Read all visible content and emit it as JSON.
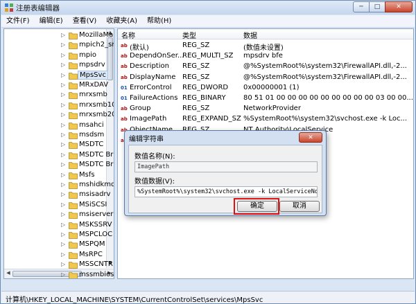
{
  "window": {
    "title": "注册表编辑器",
    "minimize": "─",
    "maximize": "□",
    "close": "✕"
  },
  "menu": [
    "文件(F)",
    "编辑(E)",
    "查看(V)",
    "收藏夹(A)",
    "帮助(H)"
  ],
  "tree": {
    "items": [
      {
        "label": "MozillaMa",
        "selected": false
      },
      {
        "label": "mpich2_sr",
        "selected": false
      },
      {
        "label": "mpio",
        "selected": false
      },
      {
        "label": "mpsdrv",
        "selected": false
      },
      {
        "label": "MpsSvc",
        "selected": true
      },
      {
        "label": "MRxDAV",
        "selected": false
      },
      {
        "label": "mrxsmb",
        "selected": false
      },
      {
        "label": "mrxsmb10",
        "selected": false
      },
      {
        "label": "mrxsmb20",
        "selected": false
      },
      {
        "label": "msahci",
        "selected": false
      },
      {
        "label": "msdsm",
        "selected": false
      },
      {
        "label": "MSDTC",
        "selected": false
      },
      {
        "label": "MSDTC Br",
        "selected": false
      },
      {
        "label": "MSDTC Br",
        "selected": false
      },
      {
        "label": "Msfs",
        "selected": false
      },
      {
        "label": "mshidkmd",
        "selected": false
      },
      {
        "label": "msisadrv",
        "selected": false
      },
      {
        "label": "MSiSCSI",
        "selected": false
      },
      {
        "label": "msiserver",
        "selected": false
      },
      {
        "label": "MSKSSRV",
        "selected": false
      },
      {
        "label": "MSPCLOC",
        "selected": false
      },
      {
        "label": "MSPQM",
        "selected": false
      },
      {
        "label": "MsRPC",
        "selected": false
      },
      {
        "label": "MSSCNTR",
        "selected": false
      },
      {
        "label": "mssmbios",
        "selected": false
      }
    ]
  },
  "list": {
    "columns": [
      "名称",
      "类型",
      "数据"
    ],
    "rows": [
      {
        "icon": "ab",
        "name": "(默认)",
        "type": "REG_SZ",
        "data": "(数值未设置)"
      },
      {
        "icon": "ab",
        "name": "DependOnSer...",
        "type": "REG_MULTI_SZ",
        "data": "mpsdrv bfe"
      },
      {
        "icon": "ab",
        "name": "Description",
        "type": "REG_SZ",
        "data": "@%SystemRoot%\\system32\\FirewallAPI.dll,-2..."
      },
      {
        "icon": "ab",
        "name": "DisplayName",
        "type": "REG_SZ",
        "data": "@%SystemRoot%\\system32\\FirewallAPI.dll,-2..."
      },
      {
        "icon": "bin",
        "name": "ErrorControl",
        "type": "REG_DWORD",
        "data": "0x00000001 (1)"
      },
      {
        "icon": "bin",
        "name": "FailureActions",
        "type": "REG_BINARY",
        "data": "80 51 01 00 00 00 00 00 00 00 00 00 03 00 00..."
      },
      {
        "icon": "ab",
        "name": "Group",
        "type": "REG_SZ",
        "data": "NetworkProvider"
      },
      {
        "icon": "ab",
        "name": "ImagePath",
        "type": "REG_EXPAND_SZ",
        "data": "%SystemRoot%\\system32\\svchost.exe -k Loc..."
      },
      {
        "icon": "ab",
        "name": "ObjectName",
        "type": "REG_SZ",
        "data": "NT Authority\\LocalService"
      },
      {
        "icon": "ab",
        "name": "",
        "type": "",
        "data": "ege SeAuditPrivile..."
      }
    ]
  },
  "dialog": {
    "title": "编辑字符串",
    "close": "✕",
    "value_name_label": "数值名称(N):",
    "value_name": "ImagePath",
    "value_data_label": "数值数据(V):",
    "value_data": "%SystemRoot%\\system32\\svchost.exe -k LocalServiceNoNetwork",
    "ok": "确定",
    "cancel": "取消"
  },
  "status": "计算机\\HKEY_LOCAL_MACHINE\\SYSTEM\\CurrentControlSet\\services\\MpsSvc"
}
